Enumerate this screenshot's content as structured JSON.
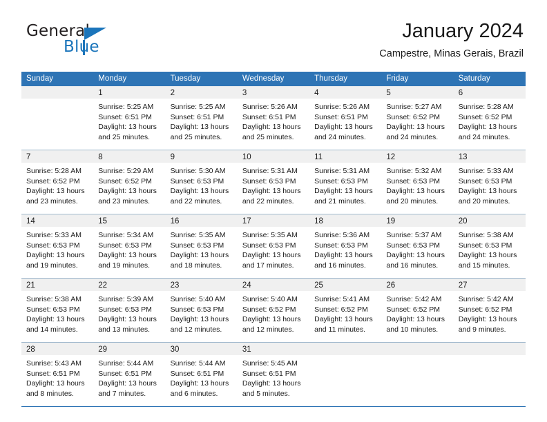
{
  "brand": {
    "name_part1": "General",
    "name_part2": "Blue",
    "accent_color": "#1b75bb"
  },
  "header": {
    "title": "January 2024",
    "subtitle": "Campestre, Minas Gerais, Brazil"
  },
  "calendar": {
    "header_color": "#2e74b5",
    "day_band_color": "#f0f0f0",
    "weekdays": [
      "Sunday",
      "Monday",
      "Tuesday",
      "Wednesday",
      "Thursday",
      "Friday",
      "Saturday"
    ],
    "weeks": [
      [
        {
          "day": "",
          "sunrise": "",
          "sunset": "",
          "daylight_line1": "",
          "daylight_line2": ""
        },
        {
          "day": "1",
          "sunrise": "Sunrise: 5:25 AM",
          "sunset": "Sunset: 6:51 PM",
          "daylight_line1": "Daylight: 13 hours",
          "daylight_line2": "and 25 minutes."
        },
        {
          "day": "2",
          "sunrise": "Sunrise: 5:25 AM",
          "sunset": "Sunset: 6:51 PM",
          "daylight_line1": "Daylight: 13 hours",
          "daylight_line2": "and 25 minutes."
        },
        {
          "day": "3",
          "sunrise": "Sunrise: 5:26 AM",
          "sunset": "Sunset: 6:51 PM",
          "daylight_line1": "Daylight: 13 hours",
          "daylight_line2": "and 25 minutes."
        },
        {
          "day": "4",
          "sunrise": "Sunrise: 5:26 AM",
          "sunset": "Sunset: 6:51 PM",
          "daylight_line1": "Daylight: 13 hours",
          "daylight_line2": "and 24 minutes."
        },
        {
          "day": "5",
          "sunrise": "Sunrise: 5:27 AM",
          "sunset": "Sunset: 6:52 PM",
          "daylight_line1": "Daylight: 13 hours",
          "daylight_line2": "and 24 minutes."
        },
        {
          "day": "6",
          "sunrise": "Sunrise: 5:28 AM",
          "sunset": "Sunset: 6:52 PM",
          "daylight_line1": "Daylight: 13 hours",
          "daylight_line2": "and 24 minutes."
        }
      ],
      [
        {
          "day": "7",
          "sunrise": "Sunrise: 5:28 AM",
          "sunset": "Sunset: 6:52 PM",
          "daylight_line1": "Daylight: 13 hours",
          "daylight_line2": "and 23 minutes."
        },
        {
          "day": "8",
          "sunrise": "Sunrise: 5:29 AM",
          "sunset": "Sunset: 6:52 PM",
          "daylight_line1": "Daylight: 13 hours",
          "daylight_line2": "and 23 minutes."
        },
        {
          "day": "9",
          "sunrise": "Sunrise: 5:30 AM",
          "sunset": "Sunset: 6:53 PM",
          "daylight_line1": "Daylight: 13 hours",
          "daylight_line2": "and 22 minutes."
        },
        {
          "day": "10",
          "sunrise": "Sunrise: 5:31 AM",
          "sunset": "Sunset: 6:53 PM",
          "daylight_line1": "Daylight: 13 hours",
          "daylight_line2": "and 22 minutes."
        },
        {
          "day": "11",
          "sunrise": "Sunrise: 5:31 AM",
          "sunset": "Sunset: 6:53 PM",
          "daylight_line1": "Daylight: 13 hours",
          "daylight_line2": "and 21 minutes."
        },
        {
          "day": "12",
          "sunrise": "Sunrise: 5:32 AM",
          "sunset": "Sunset: 6:53 PM",
          "daylight_line1": "Daylight: 13 hours",
          "daylight_line2": "and 20 minutes."
        },
        {
          "day": "13",
          "sunrise": "Sunrise: 5:33 AM",
          "sunset": "Sunset: 6:53 PM",
          "daylight_line1": "Daylight: 13 hours",
          "daylight_line2": "and 20 minutes."
        }
      ],
      [
        {
          "day": "14",
          "sunrise": "Sunrise: 5:33 AM",
          "sunset": "Sunset: 6:53 PM",
          "daylight_line1": "Daylight: 13 hours",
          "daylight_line2": "and 19 minutes."
        },
        {
          "day": "15",
          "sunrise": "Sunrise: 5:34 AM",
          "sunset": "Sunset: 6:53 PM",
          "daylight_line1": "Daylight: 13 hours",
          "daylight_line2": "and 19 minutes."
        },
        {
          "day": "16",
          "sunrise": "Sunrise: 5:35 AM",
          "sunset": "Sunset: 6:53 PM",
          "daylight_line1": "Daylight: 13 hours",
          "daylight_line2": "and 18 minutes."
        },
        {
          "day": "17",
          "sunrise": "Sunrise: 5:35 AM",
          "sunset": "Sunset: 6:53 PM",
          "daylight_line1": "Daylight: 13 hours",
          "daylight_line2": "and 17 minutes."
        },
        {
          "day": "18",
          "sunrise": "Sunrise: 5:36 AM",
          "sunset": "Sunset: 6:53 PM",
          "daylight_line1": "Daylight: 13 hours",
          "daylight_line2": "and 16 minutes."
        },
        {
          "day": "19",
          "sunrise": "Sunrise: 5:37 AM",
          "sunset": "Sunset: 6:53 PM",
          "daylight_line1": "Daylight: 13 hours",
          "daylight_line2": "and 16 minutes."
        },
        {
          "day": "20",
          "sunrise": "Sunrise: 5:38 AM",
          "sunset": "Sunset: 6:53 PM",
          "daylight_line1": "Daylight: 13 hours",
          "daylight_line2": "and 15 minutes."
        }
      ],
      [
        {
          "day": "21",
          "sunrise": "Sunrise: 5:38 AM",
          "sunset": "Sunset: 6:53 PM",
          "daylight_line1": "Daylight: 13 hours",
          "daylight_line2": "and 14 minutes."
        },
        {
          "day": "22",
          "sunrise": "Sunrise: 5:39 AM",
          "sunset": "Sunset: 6:53 PM",
          "daylight_line1": "Daylight: 13 hours",
          "daylight_line2": "and 13 minutes."
        },
        {
          "day": "23",
          "sunrise": "Sunrise: 5:40 AM",
          "sunset": "Sunset: 6:53 PM",
          "daylight_line1": "Daylight: 13 hours",
          "daylight_line2": "and 12 minutes."
        },
        {
          "day": "24",
          "sunrise": "Sunrise: 5:40 AM",
          "sunset": "Sunset: 6:52 PM",
          "daylight_line1": "Daylight: 13 hours",
          "daylight_line2": "and 12 minutes."
        },
        {
          "day": "25",
          "sunrise": "Sunrise: 5:41 AM",
          "sunset": "Sunset: 6:52 PM",
          "daylight_line1": "Daylight: 13 hours",
          "daylight_line2": "and 11 minutes."
        },
        {
          "day": "26",
          "sunrise": "Sunrise: 5:42 AM",
          "sunset": "Sunset: 6:52 PM",
          "daylight_line1": "Daylight: 13 hours",
          "daylight_line2": "and 10 minutes."
        },
        {
          "day": "27",
          "sunrise": "Sunrise: 5:42 AM",
          "sunset": "Sunset: 6:52 PM",
          "daylight_line1": "Daylight: 13 hours",
          "daylight_line2": "and 9 minutes."
        }
      ],
      [
        {
          "day": "28",
          "sunrise": "Sunrise: 5:43 AM",
          "sunset": "Sunset: 6:51 PM",
          "daylight_line1": "Daylight: 13 hours",
          "daylight_line2": "and 8 minutes."
        },
        {
          "day": "29",
          "sunrise": "Sunrise: 5:44 AM",
          "sunset": "Sunset: 6:51 PM",
          "daylight_line1": "Daylight: 13 hours",
          "daylight_line2": "and 7 minutes."
        },
        {
          "day": "30",
          "sunrise": "Sunrise: 5:44 AM",
          "sunset": "Sunset: 6:51 PM",
          "daylight_line1": "Daylight: 13 hours",
          "daylight_line2": "and 6 minutes."
        },
        {
          "day": "31",
          "sunrise": "Sunrise: 5:45 AM",
          "sunset": "Sunset: 6:51 PM",
          "daylight_line1": "Daylight: 13 hours",
          "daylight_line2": "and 5 minutes."
        },
        {
          "day": "",
          "sunrise": "",
          "sunset": "",
          "daylight_line1": "",
          "daylight_line2": ""
        },
        {
          "day": "",
          "sunrise": "",
          "sunset": "",
          "daylight_line1": "",
          "daylight_line2": ""
        },
        {
          "day": "",
          "sunrise": "",
          "sunset": "",
          "daylight_line1": "",
          "daylight_line2": ""
        }
      ]
    ]
  }
}
